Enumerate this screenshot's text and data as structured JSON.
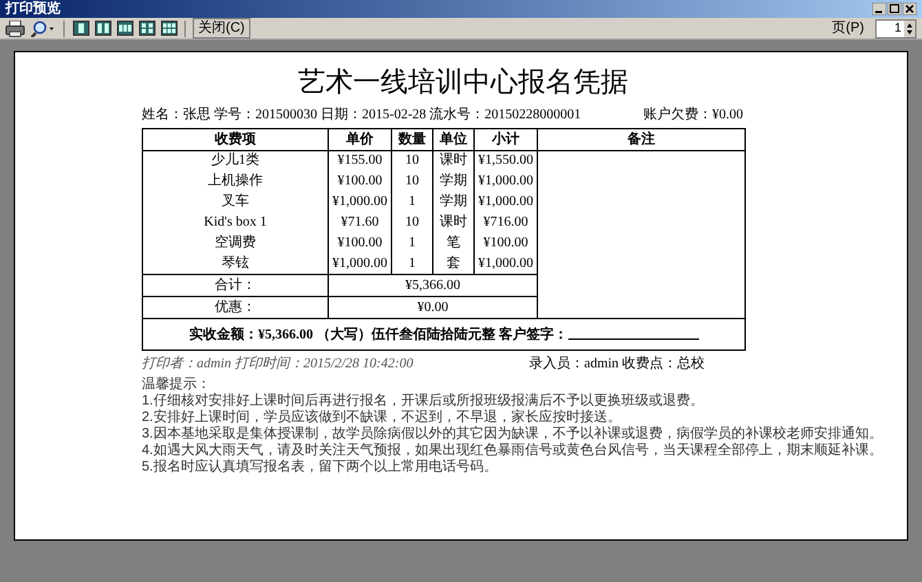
{
  "window": {
    "title": "打印预览"
  },
  "toolbar": {
    "close_button": "关闭(C)",
    "page_label": "页(P)",
    "page_value": "1"
  },
  "receipt": {
    "title": "艺术一线培训中心报名凭据",
    "info": "姓名：张思 学号：201500030 日期：2015-02-28 流水号：20150228000001",
    "arrears": "账户欠费：¥0.00",
    "columns": [
      "收费项",
      "单价",
      "数量",
      "单位",
      "小计",
      "备注"
    ],
    "rows": [
      {
        "item": "少儿1类",
        "price": "¥155.00",
        "qty": "10",
        "unit": "课时",
        "subtotal": "¥1,550.00"
      },
      {
        "item": "上机操作",
        "price": "¥100.00",
        "qty": "10",
        "unit": "学期",
        "subtotal": "¥1,000.00"
      },
      {
        "item": "叉车",
        "price": "¥1,000.00",
        "qty": "1",
        "unit": "学期",
        "subtotal": "¥1,000.00"
      },
      {
        "item": "Kid's box 1",
        "price": "¥71.60",
        "qty": "10",
        "unit": "课时",
        "subtotal": "¥716.00"
      },
      {
        "item": "空调费",
        "price": "¥100.00",
        "qty": "1",
        "unit": "笔",
        "subtotal": "¥100.00"
      },
      {
        "item": "琴铉",
        "price": "¥1,000.00",
        "qty": "1",
        "unit": "套",
        "subtotal": "¥1,000.00"
      }
    ],
    "total_label": "合计：",
    "total": "¥5,366.00",
    "discount_label": "优惠：",
    "discount": "¥0.00",
    "received": "实收金额：¥5,366.00 （大写）伍仟叁佰陆拾陆元整  客户签字：",
    "printed_by": "打印者：admin 打印时间：2015/2/28 10:42:00",
    "entered_by": "录入员：admin 收费点：总校",
    "notes_title": "温馨提示：",
    "notes": [
      "1.仔细核对安排好上课时间后再进行报名，开课后或所报班级报满后不予以更换班级或退费。",
      "2.安排好上课时间，学员应该做到不缺课，不迟到，不早退，家长应按时接送。",
      "3.因本基地采取是集体授课制，故学员除病假以外的其它因为缺课，不予以补课或退费，病假学员的补课校老师安排通知。",
      "4.如遇大风大雨天气，请及时关注天气预报，如果出现红色暴雨信号或黄色台风信号，当天课程全部停上，期末顺延补课。",
      "5.报名时应认真填写报名表，留下两个以上常用电话号码。"
    ]
  }
}
